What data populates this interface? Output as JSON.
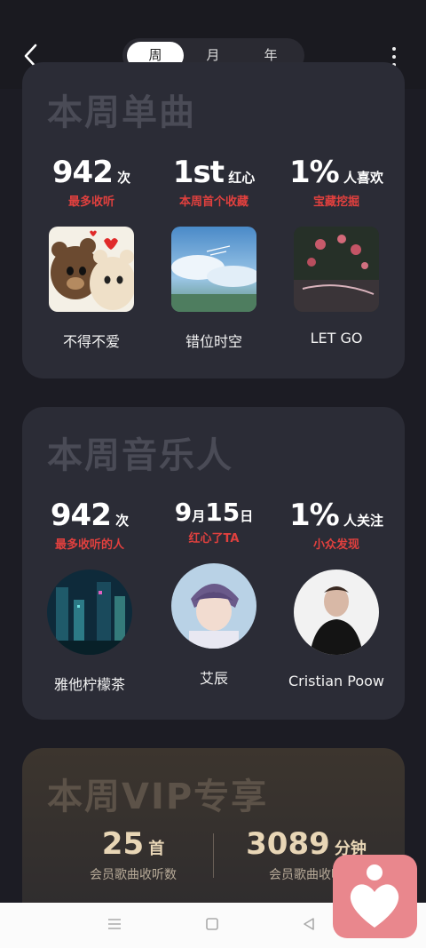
{
  "tabs": [
    {
      "label": "周",
      "active": true
    },
    {
      "label": "月",
      "active": false
    },
    {
      "label": "年",
      "active": false
    }
  ],
  "songs": {
    "title": "本周单曲",
    "stats": [
      {
        "value": "942",
        "unit": "次",
        "sub": "最多收听",
        "name": "不得不爱"
      },
      {
        "value": "1st",
        "unit": "红心",
        "sub": "本周首个收藏",
        "name": "错位时空"
      },
      {
        "value": "1%",
        "unit": "人喜欢",
        "sub": "宝藏挖掘",
        "name": "LET GO"
      }
    ]
  },
  "artists": {
    "title": "本周音乐人",
    "stats": [
      {
        "value": "942",
        "unit": "次",
        "sub": "最多收听的人",
        "name": "雅他柠檬茶"
      },
      {
        "month": "9",
        "month_unit": "月",
        "day": "15",
        "day_unit": "日",
        "sub": "红心了TA",
        "name": "艾辰"
      },
      {
        "value": "1%",
        "unit": "人关注",
        "sub": "小众发现",
        "name": "Cristian Poow"
      }
    ]
  },
  "vip": {
    "title": "本周VIP专享",
    "left": {
      "value": "25",
      "unit": "首",
      "sub": "会员歌曲收听数"
    },
    "right": {
      "value": "3089",
      "unit": "分钟",
      "sub": "会员歌曲收听"
    }
  },
  "colors": {
    "accent_red": "#e0403e",
    "card_bg": "#2b2c36",
    "vip_gold": "#e8d6b6",
    "fab": "#e9878d"
  },
  "icons": [
    "back-arrow-icon",
    "more-vert-icon",
    "nav-menu-icon",
    "nav-home-icon",
    "nav-back-icon",
    "heart-person-icon"
  ]
}
